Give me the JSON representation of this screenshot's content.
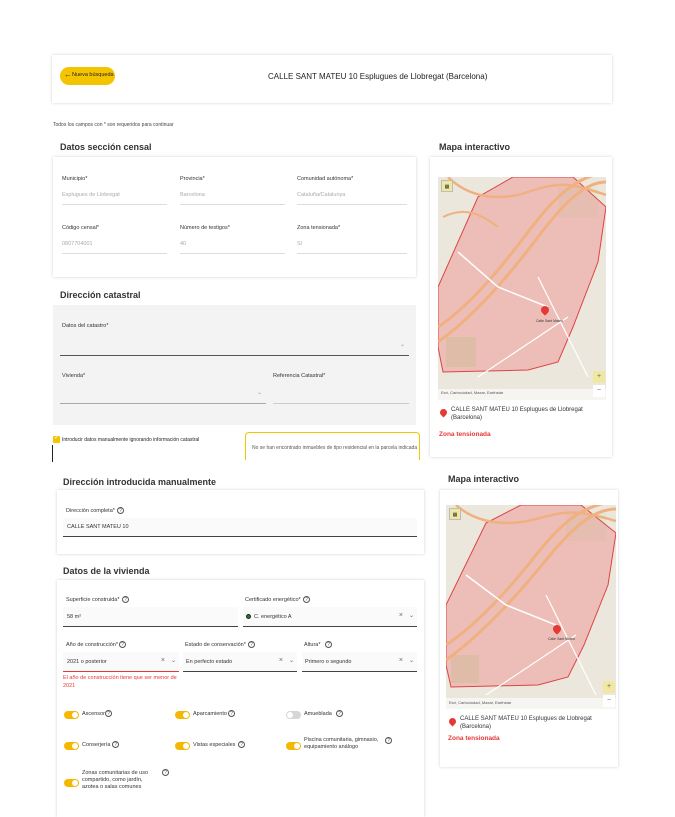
{
  "header": {
    "back_label": "Nueva búsqueda",
    "address_title": "CALLE SANT MATEU 10 Esplugues de Llobregat (Barcelona)"
  },
  "required_note": "Todos los campos con * son requeridos para continuar",
  "censal": {
    "title": "Datos sección censal",
    "municipio_label": "Municipio*",
    "municipio_value": "Esplugues de Llobregat",
    "provincia_label": "Provincia*",
    "provincia_value": "Barcelona",
    "comunidad_label": "Comunidad autónoma*",
    "comunidad_value": "Cataluña/Catalunya",
    "codigo_label": "Código censal*",
    "codigo_value": "0807704001",
    "testigos_label": "Número de testigos*",
    "testigos_value": "40",
    "tensionada_label": "Zona tensionada*",
    "tensionada_value": "Sí"
  },
  "catastral": {
    "title": "Dirección catastral",
    "datos_label": "Datos del catastro*",
    "vivienda_label": "Vivienda*",
    "referencia_label": "Referencia Catastral*",
    "manual_checkbox_label": "Introducir datos manualmente ignorando información catastral",
    "notice": "No se han encontrado inmuebles de tipo residencial en la parcela indicada"
  },
  "map1": {
    "title": "Mapa interactivo",
    "address": "CALLE SANT MATEU 10 Esplugues de Llobregat (Barcelona)",
    "zone": "Zona tensionada",
    "attribution": "Esri, Cartociudad, Maxar, Earthstar",
    "zoom_in": "+",
    "zoom_out": "−",
    "pin_label": "Calle Sant Mateu"
  },
  "manual": {
    "title": "Dirección introducida manualmente",
    "direccion_label": "Dirección completa*",
    "direccion_value": "CALLE SANT MATEU 10"
  },
  "vivienda": {
    "title": "Datos de la vivienda",
    "superficie_label": "Superficie construida*",
    "superficie_value": "58 m²",
    "certificado_label": "Certificado energético*",
    "certificado_value": "C. energético A",
    "anio_label": "Año de construcción*",
    "anio_value": "2021 o posterior",
    "anio_error": "El año de construcción tiene que ser menor de 2021",
    "estado_label": "Estado de conservación*",
    "estado_value": "En perfecto estado",
    "altura_label": "Altura*",
    "altura_value": "Primero o segundo",
    "ascensor": "Ascensor",
    "aparcamiento": "Aparcamiento",
    "amueblada": "Amueblada",
    "conserjeria": "Conserjería",
    "vistas": "Vistas especiales",
    "piscina": "Piscina comunitaria, gimnasio, equipamiento análogo",
    "zonas": "Zonas comunitarias de uso compartido, como jardín, azotea o salas comunes"
  },
  "map2": {
    "title": "Mapa interactivo",
    "address": "CALLE SANT MATEU 10 Esplugues de Llobregat (Barcelona)",
    "zone": "Zona tensionada",
    "attribution": "Esri, Cartociudad, Maxar, Earthstar",
    "zoom_in": "+",
    "zoom_out": "−",
    "pin_label": "Calle Sant Mateu"
  },
  "colors": {
    "accent": "#f5c400",
    "zone_red": "#e53935",
    "error": "#e53935"
  },
  "icons": {
    "back": "arrow-left-icon",
    "help": "question-circle-icon",
    "pin": "map-pin-icon",
    "clear": "close-icon",
    "dropdown": "chevron-down-icon"
  }
}
